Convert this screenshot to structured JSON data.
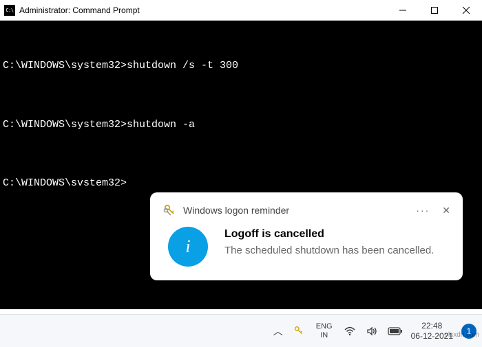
{
  "window": {
    "icon_label": "C:\\",
    "title": "Administrator: Command Prompt"
  },
  "terminal": {
    "lines": [
      {
        "prompt": "C:\\WINDOWS\\system32>",
        "cmd": "shutdown /s -t 300"
      },
      {
        "prompt": "C:\\WINDOWS\\system32>",
        "cmd": "shutdown -a"
      },
      {
        "prompt": "C:\\WINDOWS\\svstem32>",
        "cmd": ""
      }
    ]
  },
  "toast": {
    "app_name": "Windows logon reminder",
    "more_glyph": "···",
    "dismiss_glyph": "✕",
    "info_glyph": "i",
    "heading": "Logoff is cancelled",
    "message": "The scheduled shutdown has been cancelled."
  },
  "taskbar": {
    "chevron": "︿",
    "lang_top": "ENG",
    "lang_bottom": "IN",
    "time": "22:48",
    "date": "06-12-2021",
    "badge": "1"
  },
  "watermark": "vlsxdn.com",
  "colors": {
    "terminal_bg": "#000000",
    "terminal_fg": "#ffffff",
    "info_circle": "#0aa0e6",
    "badge": "#0067c0"
  }
}
